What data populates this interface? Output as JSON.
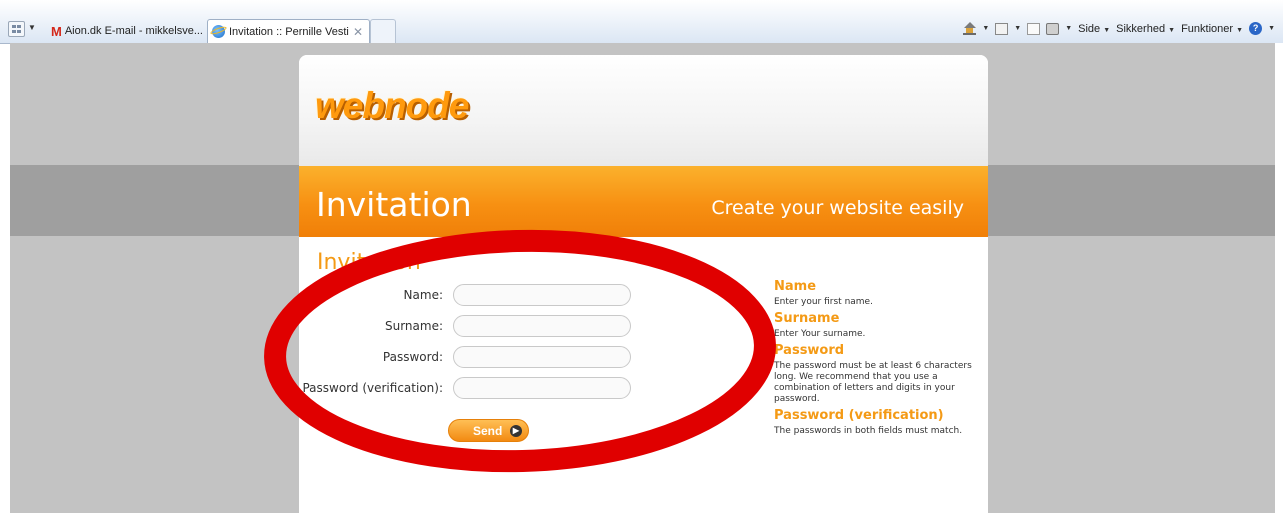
{
  "browser": {
    "tabs": [
      {
        "label": "Aion.dk E-mail - mikkelsve...",
        "icon": "gmail-icon"
      },
      {
        "label": "Invitation :: Pernille Vesti",
        "icon": "ie-icon",
        "active": true
      }
    ],
    "commands": {
      "side": "Side",
      "security": "Sikkerhed",
      "tools": "Funktioner"
    }
  },
  "page": {
    "logo_text": "webnode",
    "banner_title": "Invitation",
    "banner_tagline": "Create your website easily",
    "section_title": "Invitation",
    "form": {
      "fields": [
        {
          "label": "Name:",
          "value": ""
        },
        {
          "label": "Surname:",
          "value": ""
        },
        {
          "label": "Password:",
          "value": ""
        },
        {
          "label": "Password (verification):",
          "value": ""
        }
      ],
      "send_label": "Send"
    },
    "help": [
      {
        "title": "Name",
        "text": "Enter your first name."
      },
      {
        "title": "Surname",
        "text": "Enter Your surname."
      },
      {
        "title": "Password",
        "text": "The password must be at least 6 characters long. We recommend that you use a combination of letters and digits in your password."
      },
      {
        "title": "Password (verification)",
        "text": "The passwords in both fields must match."
      }
    ]
  },
  "colors": {
    "accent_orange": "#f49a15",
    "annotation_red": "#e00000",
    "page_gray": "#c3c3c3"
  }
}
